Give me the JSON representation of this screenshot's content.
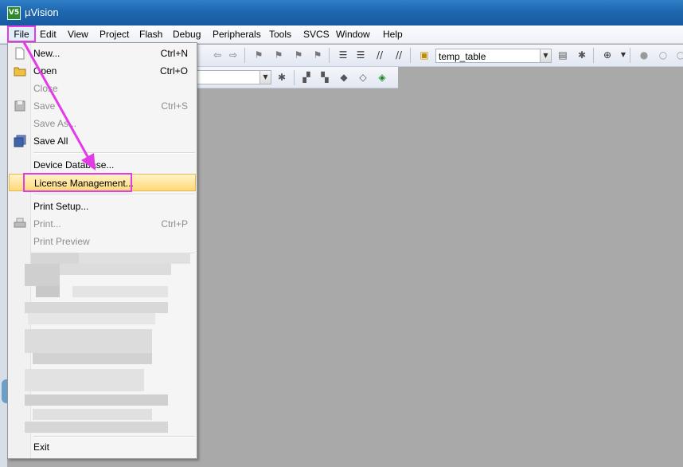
{
  "window": {
    "title": "µVision",
    "icon_text": "V5"
  },
  "menubar": {
    "items": [
      "File",
      "Edit",
      "View",
      "Project",
      "Flash",
      "Debug",
      "Peripherals",
      "Tools",
      "SVCS",
      "Window",
      "Help"
    ]
  },
  "toolbar": {
    "target_combo": "temp_table"
  },
  "file_menu": {
    "new": {
      "label": "New...",
      "shortcut": "Ctrl+N"
    },
    "open": {
      "label": "Open",
      "shortcut": "Ctrl+O"
    },
    "close": {
      "label": "Close"
    },
    "save": {
      "label": "Save",
      "shortcut": "Ctrl+S"
    },
    "save_as": {
      "label": "Save As..."
    },
    "save_all": {
      "label": "Save All"
    },
    "device_database": {
      "label": "Device Database..."
    },
    "license_management": {
      "label": "License Management..."
    },
    "print_setup": {
      "label": "Print Setup..."
    },
    "print": {
      "label": "Print...",
      "shortcut": "Ctrl+P"
    },
    "print_preview": {
      "label": "Print Preview"
    },
    "exit": {
      "label": "Exit"
    }
  },
  "colors": {
    "annotation": "#e23ce6",
    "highlight": "#ffd97a",
    "titlebar": "#1f67b0"
  }
}
